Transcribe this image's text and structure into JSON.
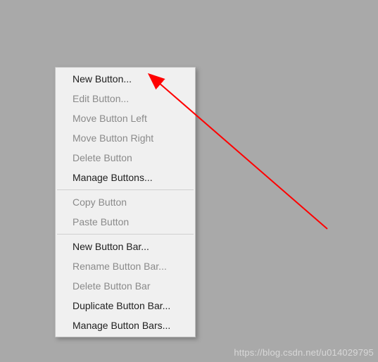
{
  "menu": {
    "items": [
      {
        "label": "New Button...",
        "disabled": false
      },
      {
        "label": "Edit Button...",
        "disabled": true
      },
      {
        "label": "Move Button Left",
        "disabled": true
      },
      {
        "label": "Move Button Right",
        "disabled": true
      },
      {
        "label": "Delete Button",
        "disabled": true
      },
      {
        "label": "Manage Buttons...",
        "disabled": false
      }
    ],
    "items2": [
      {
        "label": "Copy Button",
        "disabled": true
      },
      {
        "label": "Paste Button",
        "disabled": true
      }
    ],
    "items3": [
      {
        "label": "New Button Bar...",
        "disabled": false
      },
      {
        "label": "Rename Button Bar...",
        "disabled": true
      },
      {
        "label": "Delete Button Bar",
        "disabled": true
      },
      {
        "label": "Duplicate Button Bar...",
        "disabled": false
      },
      {
        "label": "Manage Button Bars...",
        "disabled": false
      }
    ]
  },
  "annotation": {
    "arrow_color": "#ff0000"
  },
  "watermark": "https://blog.csdn.net/u014029795"
}
